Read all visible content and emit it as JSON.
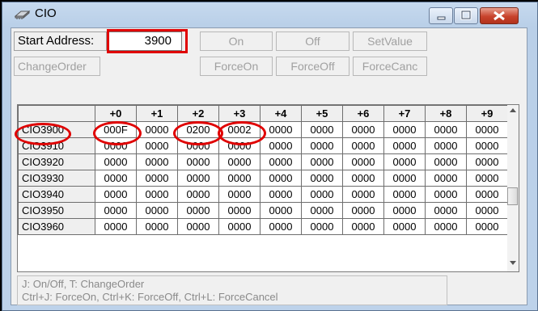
{
  "window": {
    "title": "CIO"
  },
  "toolbar": {
    "start_address_label": "Start Address:",
    "start_address_value": "3900",
    "on_label": "On",
    "off_label": "Off",
    "setvalue_label": "SetValue",
    "changeorder_label": "ChangeOrder",
    "forceon_label": "ForceOn",
    "forceoff_label": "ForceOff",
    "forcecanc_label": "ForceCanc"
  },
  "grid": {
    "columns": [
      "+0",
      "+1",
      "+2",
      "+3",
      "+4",
      "+5",
      "+6",
      "+7",
      "+8",
      "+9"
    ],
    "rows": [
      {
        "address": "CIO3900",
        "values": [
          "000F",
          "0000",
          "0200",
          "0002",
          "0000",
          "0000",
          "0000",
          "0000",
          "0000",
          "0000"
        ]
      },
      {
        "address": "CIO3910",
        "values": [
          "0000",
          "0000",
          "0000",
          "0000",
          "0000",
          "0000",
          "0000",
          "0000",
          "0000",
          "0000"
        ]
      },
      {
        "address": "CIO3920",
        "values": [
          "0000",
          "0000",
          "0000",
          "0000",
          "0000",
          "0000",
          "0000",
          "0000",
          "0000",
          "0000"
        ]
      },
      {
        "address": "CIO3930",
        "values": [
          "0000",
          "0000",
          "0000",
          "0000",
          "0000",
          "0000",
          "0000",
          "0000",
          "0000",
          "0000"
        ]
      },
      {
        "address": "CIO3940",
        "values": [
          "0000",
          "0000",
          "0000",
          "0000",
          "0000",
          "0000",
          "0000",
          "0000",
          "0000",
          "0000"
        ]
      },
      {
        "address": "CIO3950",
        "values": [
          "0000",
          "0000",
          "0000",
          "0000",
          "0000",
          "0000",
          "0000",
          "0000",
          "0000",
          "0000"
        ]
      },
      {
        "address": "CIO3960",
        "values": [
          "0000",
          "0000",
          "0000",
          "0000",
          "0000",
          "0000",
          "0000",
          "0000",
          "0000",
          "0000"
        ]
      }
    ]
  },
  "help": {
    "line1": "J: On/Off,   T: ChangeOrder",
    "line2": "Ctrl+J: ForceOn,   Ctrl+K: ForceOff,   Ctrl+L: ForceCancel"
  },
  "colors": {
    "annotation": "#e00000",
    "titlebar": "#bdd2ea",
    "close_button": "#c8432c"
  },
  "icons": {
    "title": "chip-icon",
    "minimize": "minimize-icon",
    "maximize": "maximize-icon",
    "close": "close-icon"
  }
}
